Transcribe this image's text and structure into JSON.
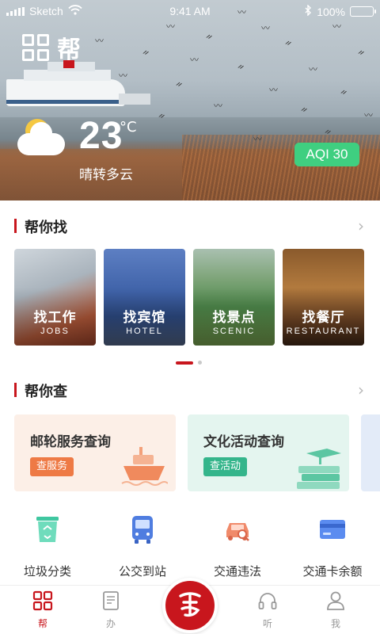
{
  "status_bar": {
    "carrier": "Sketch",
    "time": "9:41 AM",
    "battery": "100%"
  },
  "brand": {
    "text": "帮"
  },
  "weather": {
    "temperature": "23",
    "unit": "°C",
    "description": "晴转多云",
    "aqi_label": "AQI 30"
  },
  "help_find": {
    "title": "帮你找",
    "cards": [
      {
        "cn": "找工作",
        "en": "JOBS"
      },
      {
        "cn": "找宾馆",
        "en": "HOTEL"
      },
      {
        "cn": "找景点",
        "en": "SCENIC"
      },
      {
        "cn": "找餐厅",
        "en": "RESTAURANT"
      }
    ]
  },
  "help_query": {
    "title": "帮你查",
    "cards": [
      {
        "title": "邮轮服务查询",
        "button": "查服务"
      },
      {
        "title": "文化活动查询",
        "button": "查活动"
      }
    ]
  },
  "services": [
    {
      "label": "垃圾分类",
      "icon": "trash-sort-icon"
    },
    {
      "label": "公交到站",
      "icon": "bus-icon"
    },
    {
      "label": "交通违法",
      "icon": "car-search-icon"
    },
    {
      "label": "交通卡余额",
      "icon": "card-icon"
    }
  ],
  "tabbar": {
    "tabs": [
      {
        "label": "帮",
        "icon": "grid-icon",
        "active": true
      },
      {
        "label": "办",
        "icon": "document-icon",
        "active": false
      },
      {
        "label": "听",
        "icon": "headphones-icon",
        "active": false
      },
      {
        "label": "我",
        "icon": "user-icon",
        "active": false
      }
    ]
  },
  "colors": {
    "brand_red": "#c8161d",
    "aqi_green": "#3fcf80",
    "cruise_orange": "#ee7a45",
    "culture_green": "#34b58b"
  }
}
